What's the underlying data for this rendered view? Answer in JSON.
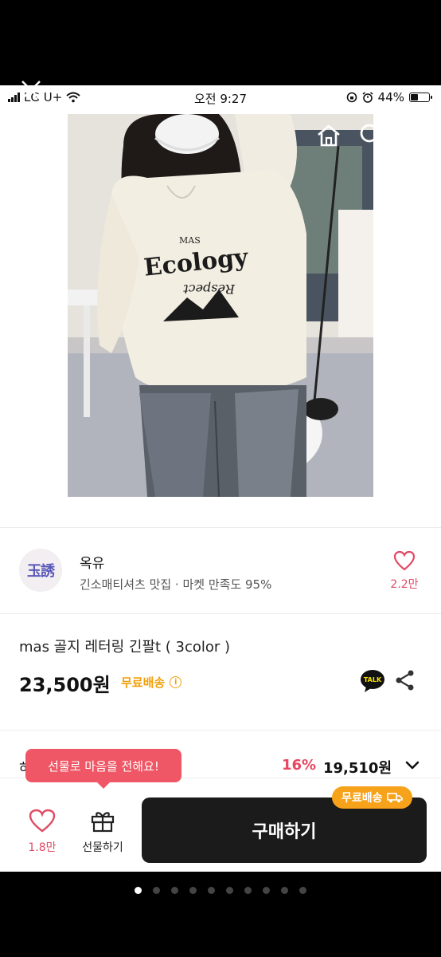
{
  "status_bar": {
    "carrier": "LG U+",
    "time": "오전 9:27",
    "battery": "44%",
    "battery_level": 0.44
  },
  "nav": {
    "back_icon": "chevron-left-icon",
    "home_icon": "home-icon",
    "search_icon": "search-icon",
    "cart_icon": "cart-icon"
  },
  "photo": {
    "shirt_text_top": "MAS",
    "shirt_text_main": "Ecology"
  },
  "seller": {
    "avatar_text": "玉誘",
    "name": "옥유",
    "meta": "긴소매티셔츠 맛집 · 마켓 만족도 95%",
    "like_count": "2.2만"
  },
  "product": {
    "title": "mas 골지 레터링 긴팔t ( 3color )",
    "price": "23,500원",
    "shipping": "무료배송",
    "talk_label": "TALK"
  },
  "option": {
    "label_partial": "하",
    "discount": "16%",
    "price": "19,510원"
  },
  "tooltip": "선물로 마음을 전해요!",
  "bottom": {
    "like_count": "1.8만",
    "gift_label": "선물하기",
    "buy_label": "구매하기",
    "freeship_badge": "무료배송"
  },
  "carousel": {
    "count": 10,
    "active_index": 0
  },
  "colors": {
    "accent_pink": "#e04a64",
    "shipping_orange": "#f0a00a",
    "buy_button": "#1b1b1b"
  }
}
